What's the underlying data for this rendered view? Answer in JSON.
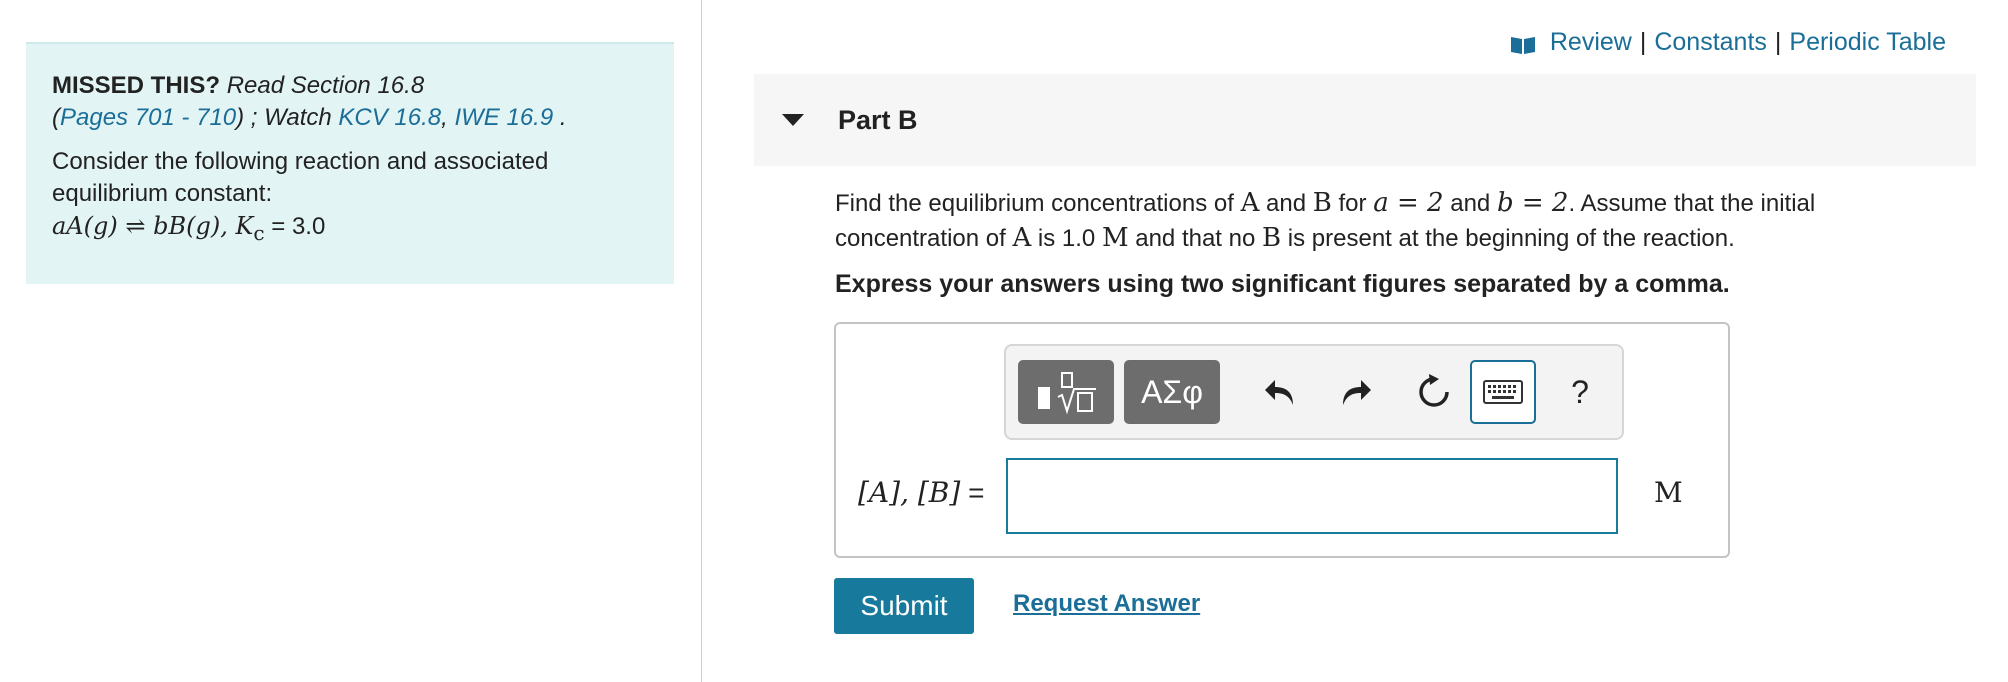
{
  "missed": {
    "label": "MISSED THIS?",
    "read_text": "Read Section 16.8",
    "paren_open": "(",
    "pages_link": "Pages 701 - 710",
    "paren_close_watch": ") ; Watch",
    "kcv_link": "KCV 16.8",
    "comma": ",",
    "iwe_link": "IWE 16.9",
    "period": " ."
  },
  "problem": {
    "intro": "Consider the following reaction and associated equilibrium constant:",
    "reaction": "aA(g) ⇌ bB(g), ",
    "kc_symbol": "K",
    "kc_sub": "c",
    "kc_value": " = 3.0"
  },
  "top_links": {
    "review": "Review",
    "sep1": "|",
    "constants": "Constants",
    "sep2": "|",
    "periodic_table": "Periodic Table"
  },
  "part": {
    "title": "Part B"
  },
  "question": {
    "t1": "Find the equilibrium concentrations of ",
    "m1": "A",
    "t2": " and ",
    "m2": "B",
    "t3": " for ",
    "m3": "a = 2",
    "t4": " and ",
    "m4": "b = 2",
    "t5": ". Assume that the initial concentration of ",
    "m5": "A",
    "t6": " is 1.0 ",
    "m6": "M",
    "t7": " and that no ",
    "m7": "B",
    "t8": " is present at the beginning of the reaction."
  },
  "instruction": "Express your answers using two significant figures separated by a comma.",
  "toolbar": {
    "greek_label": "ΑΣφ",
    "help_label": "?"
  },
  "answer": {
    "label": "[A], [B]",
    "equals": " =",
    "value": "",
    "unit": "M"
  },
  "actions": {
    "submit": "Submit",
    "request_answer": "Request Answer"
  },
  "colors": {
    "accent": "#17799c",
    "panel_bg": "#e3f4f5",
    "link": "#1a6e97"
  }
}
